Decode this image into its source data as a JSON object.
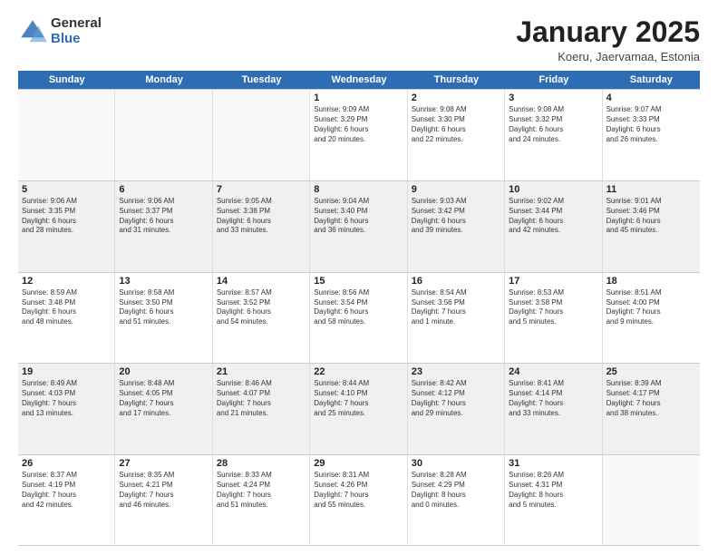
{
  "logo": {
    "general": "General",
    "blue": "Blue"
  },
  "header": {
    "month": "January 2025",
    "location": "Koeru, Jaervamaa, Estonia"
  },
  "weekdays": [
    "Sunday",
    "Monday",
    "Tuesday",
    "Wednesday",
    "Thursday",
    "Friday",
    "Saturday"
  ],
  "weeks": [
    [
      {
        "day": "",
        "info": "",
        "empty": true
      },
      {
        "day": "",
        "info": "",
        "empty": true
      },
      {
        "day": "",
        "info": "",
        "empty": true
      },
      {
        "day": "1",
        "info": "Sunrise: 9:09 AM\nSunset: 3:29 PM\nDaylight: 6 hours\nand 20 minutes.",
        "empty": false
      },
      {
        "day": "2",
        "info": "Sunrise: 9:08 AM\nSunset: 3:30 PM\nDaylight: 6 hours\nand 22 minutes.",
        "empty": false
      },
      {
        "day": "3",
        "info": "Sunrise: 9:08 AM\nSunset: 3:32 PM\nDaylight: 6 hours\nand 24 minutes.",
        "empty": false
      },
      {
        "day": "4",
        "info": "Sunrise: 9:07 AM\nSunset: 3:33 PM\nDaylight: 6 hours\nand 26 minutes.",
        "empty": false
      }
    ],
    [
      {
        "day": "5",
        "info": "Sunrise: 9:06 AM\nSunset: 3:35 PM\nDaylight: 6 hours\nand 28 minutes.",
        "empty": false
      },
      {
        "day": "6",
        "info": "Sunrise: 9:06 AM\nSunset: 3:37 PM\nDaylight: 6 hours\nand 31 minutes.",
        "empty": false
      },
      {
        "day": "7",
        "info": "Sunrise: 9:05 AM\nSunset: 3:38 PM\nDaylight: 6 hours\nand 33 minutes.",
        "empty": false
      },
      {
        "day": "8",
        "info": "Sunrise: 9:04 AM\nSunset: 3:40 PM\nDaylight: 6 hours\nand 36 minutes.",
        "empty": false
      },
      {
        "day": "9",
        "info": "Sunrise: 9:03 AM\nSunset: 3:42 PM\nDaylight: 6 hours\nand 39 minutes.",
        "empty": false
      },
      {
        "day": "10",
        "info": "Sunrise: 9:02 AM\nSunset: 3:44 PM\nDaylight: 6 hours\nand 42 minutes.",
        "empty": false
      },
      {
        "day": "11",
        "info": "Sunrise: 9:01 AM\nSunset: 3:46 PM\nDaylight: 6 hours\nand 45 minutes.",
        "empty": false
      }
    ],
    [
      {
        "day": "12",
        "info": "Sunrise: 8:59 AM\nSunset: 3:48 PM\nDaylight: 6 hours\nand 48 minutes.",
        "empty": false
      },
      {
        "day": "13",
        "info": "Sunrise: 8:58 AM\nSunset: 3:50 PM\nDaylight: 6 hours\nand 51 minutes.",
        "empty": false
      },
      {
        "day": "14",
        "info": "Sunrise: 8:57 AM\nSunset: 3:52 PM\nDaylight: 6 hours\nand 54 minutes.",
        "empty": false
      },
      {
        "day": "15",
        "info": "Sunrise: 8:56 AM\nSunset: 3:54 PM\nDaylight: 6 hours\nand 58 minutes.",
        "empty": false
      },
      {
        "day": "16",
        "info": "Sunrise: 8:54 AM\nSunset: 3:56 PM\nDaylight: 7 hours\nand 1 minute.",
        "empty": false
      },
      {
        "day": "17",
        "info": "Sunrise: 8:53 AM\nSunset: 3:58 PM\nDaylight: 7 hours\nand 5 minutes.",
        "empty": false
      },
      {
        "day": "18",
        "info": "Sunrise: 8:51 AM\nSunset: 4:00 PM\nDaylight: 7 hours\nand 9 minutes.",
        "empty": false
      }
    ],
    [
      {
        "day": "19",
        "info": "Sunrise: 8:49 AM\nSunset: 4:03 PM\nDaylight: 7 hours\nand 13 minutes.",
        "empty": false
      },
      {
        "day": "20",
        "info": "Sunrise: 8:48 AM\nSunset: 4:05 PM\nDaylight: 7 hours\nand 17 minutes.",
        "empty": false
      },
      {
        "day": "21",
        "info": "Sunrise: 8:46 AM\nSunset: 4:07 PM\nDaylight: 7 hours\nand 21 minutes.",
        "empty": false
      },
      {
        "day": "22",
        "info": "Sunrise: 8:44 AM\nSunset: 4:10 PM\nDaylight: 7 hours\nand 25 minutes.",
        "empty": false
      },
      {
        "day": "23",
        "info": "Sunrise: 8:42 AM\nSunset: 4:12 PM\nDaylight: 7 hours\nand 29 minutes.",
        "empty": false
      },
      {
        "day": "24",
        "info": "Sunrise: 8:41 AM\nSunset: 4:14 PM\nDaylight: 7 hours\nand 33 minutes.",
        "empty": false
      },
      {
        "day": "25",
        "info": "Sunrise: 8:39 AM\nSunset: 4:17 PM\nDaylight: 7 hours\nand 38 minutes.",
        "empty": false
      }
    ],
    [
      {
        "day": "26",
        "info": "Sunrise: 8:37 AM\nSunset: 4:19 PM\nDaylight: 7 hours\nand 42 minutes.",
        "empty": false
      },
      {
        "day": "27",
        "info": "Sunrise: 8:35 AM\nSunset: 4:21 PM\nDaylight: 7 hours\nand 46 minutes.",
        "empty": false
      },
      {
        "day": "28",
        "info": "Sunrise: 8:33 AM\nSunset: 4:24 PM\nDaylight: 7 hours\nand 51 minutes.",
        "empty": false
      },
      {
        "day": "29",
        "info": "Sunrise: 8:31 AM\nSunset: 4:26 PM\nDaylight: 7 hours\nand 55 minutes.",
        "empty": false
      },
      {
        "day": "30",
        "info": "Sunrise: 8:28 AM\nSunset: 4:29 PM\nDaylight: 8 hours\nand 0 minutes.",
        "empty": false
      },
      {
        "day": "31",
        "info": "Sunrise: 8:26 AM\nSunset: 4:31 PM\nDaylight: 8 hours\nand 5 minutes.",
        "empty": false
      },
      {
        "day": "",
        "info": "",
        "empty": true
      }
    ]
  ]
}
